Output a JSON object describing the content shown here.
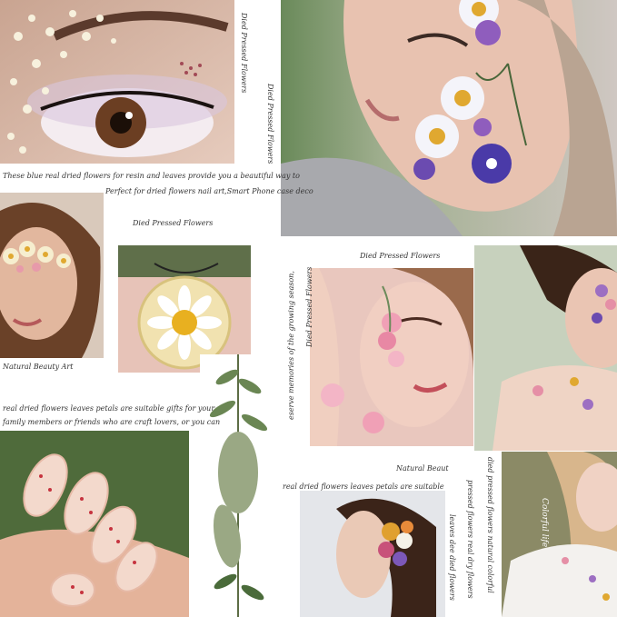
{
  "captions": {
    "top_vertical_1": "Died Pressed Flowers",
    "top_vertical_2": "Died Pressed Flowers",
    "desc_line_1": "These blue real dried flowers for resin and leaves provide you a beautiful way to",
    "desc_line_2": "Perfect for dried flowers nail art,Smart Phone case deco",
    "pendant_title": "Died Pressed Flowers",
    "center_title": "Died Pressed Flowers",
    "center_vertical": "Died Pressed Flowers",
    "season_vertical": "eserve memories of the growing season,",
    "beauty_art": "Natural Beauty Art",
    "gift_line_1": "real dried flowers leaves petals are suitable gifts for your",
    "gift_line_2": "family members or friends who are craft lovers, or you can",
    "natural_beaut": "Natural Beaut",
    "bottom_line": "real dried flowers leaves petals are suitable",
    "right_vertical_1": "died pressed flowers natural colorful",
    "right_vertical_2": "pressed flowers real dry flowers",
    "right_vertical_3": "leaves dee died flowers",
    "signature": "Colorful life"
  },
  "photos": [
    "eye-closeup-with-white-flowers",
    "face-with-pressed-daisies",
    "woman-with-flower-crown",
    "resin-daisy-pendant",
    "woman-with-pink-flowers-face",
    "woman-with-flowers-shoulder",
    "nails-with-dried-petals",
    "pressed-fern-leaves",
    "woman-with-flowers-in-hair",
    "bride-with-flower-tattoo"
  ],
  "colors": {
    "background": "#ffffff",
    "text": "#333333"
  }
}
